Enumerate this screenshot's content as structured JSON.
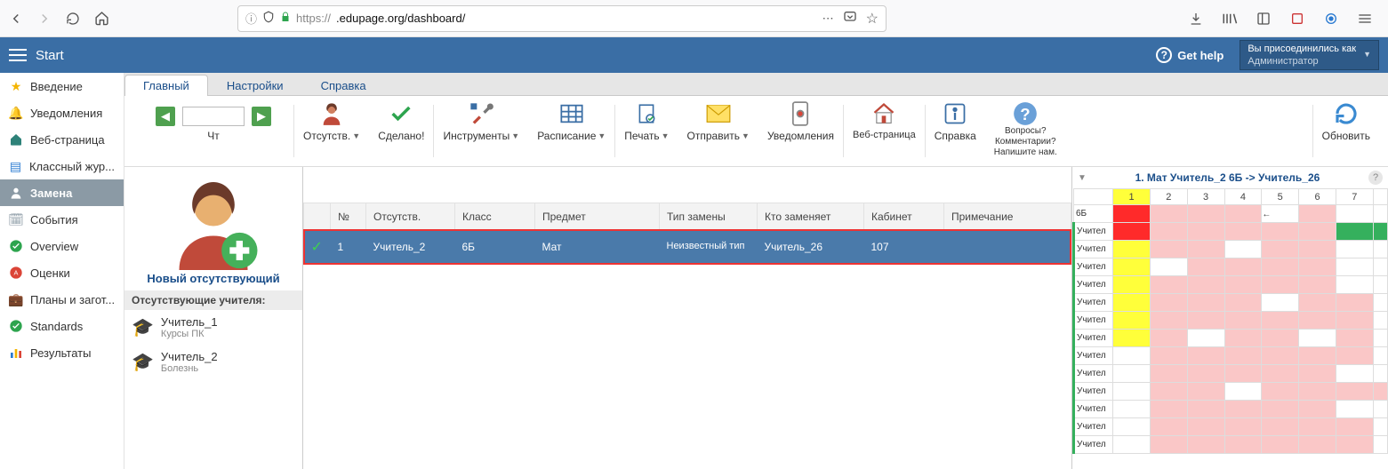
{
  "browser": {
    "protocol": "https://",
    "host": ".edupage.org/dashboard/",
    "info_glyph": "ⓘ",
    "shield_glyph": "🛡",
    "lock_glyph": "🔒",
    "dots": "⋯",
    "pocket": "◡",
    "star": "☆",
    "download": "⭳",
    "library": "⫴\\",
    "reader": "▯",
    "m_icon": "▯",
    "globe": "◉",
    "menu": "☰"
  },
  "header": {
    "title": "Start",
    "help": "Get help",
    "joined_as": "Вы присоединились как",
    "role": "Администратор"
  },
  "sidebar": [
    {
      "icon": "★",
      "cls": "col-yellow",
      "label": "Введение"
    },
    {
      "icon": "🔔",
      "cls": "col-teal",
      "label": "Уведомления"
    },
    {
      "icon": "⌂",
      "cls": "col-teal-fill",
      "label": "Веб-страница"
    },
    {
      "icon": "▤",
      "cls": "col-blue",
      "label": "Классный жур..."
    },
    {
      "icon": "👤",
      "cls": "",
      "label": "Замена",
      "active": true
    },
    {
      "icon": "🗓",
      "cls": "col-gray",
      "label": "События"
    },
    {
      "icon": "✔",
      "cls": "col-green",
      "label": "Overview"
    },
    {
      "icon": "A+",
      "cls": "col-red",
      "label": "Оценки"
    },
    {
      "icon": "💼",
      "cls": "col-teal2",
      "label": "Планы и загот..."
    },
    {
      "icon": "✔",
      "cls": "col-green",
      "label": "Standards"
    },
    {
      "icon": "▮▮",
      "cls": "col-bar",
      "label": "Результаты"
    }
  ],
  "tabs": [
    {
      "label": "Главный",
      "active": true
    },
    {
      "label": "Настройки"
    },
    {
      "label": "Справка"
    }
  ],
  "toolbar": {
    "day": "Чт",
    "absent": "Отсутств.",
    "done": "Сделано!",
    "tools": "Инструменты",
    "schedule": "Расписание",
    "print": "Печать",
    "send": "Отправить",
    "notifs": "Уведомления",
    "webpage": "Веб-страница",
    "help": "Справка",
    "qline1": "Вопросы?",
    "qline2": "Комментарии?",
    "qline3": "Напишите нам.",
    "refresh": "Обновить"
  },
  "absent": {
    "new": "Новый отсутствующий",
    "header": "Отсутствующие учителя:",
    "teachers": [
      {
        "name": "Учитель_1",
        "reason": "Курсы ПК"
      },
      {
        "name": "Учитель_2",
        "reason": "Болезнь"
      }
    ]
  },
  "table": {
    "headers": [
      "№",
      "Отсутств.",
      "Класс",
      "Предмет",
      "Тип замены",
      "Кто заменяет",
      "Кабинет",
      "Примечание"
    ],
    "row": {
      "check": "✓",
      "num": "1",
      "absent": "Учитель_2",
      "klass": "6Б",
      "subj": "Мат",
      "type": "Неизвестный тип",
      "who": "Учитель_26",
      "room": "107",
      "note": ""
    }
  },
  "sched": {
    "title": "1. Мат Учитель_2 6Б -> Учитель_26",
    "periods": [
      "1",
      "2",
      "3",
      "4",
      "5",
      "6",
      "7"
    ],
    "rows": [
      "6Б",
      "Учител",
      "Учител",
      "Учител",
      "Учител",
      "Учител",
      "Учител",
      "Учител",
      "Учител",
      "Учител",
      "Учител",
      "Учител",
      "Учител",
      "Учител"
    ],
    "back_arrow": "←"
  }
}
